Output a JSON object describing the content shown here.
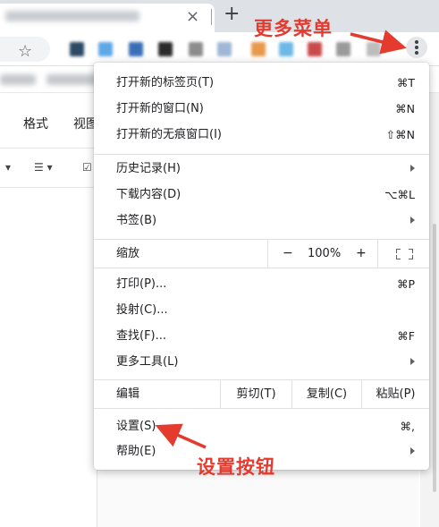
{
  "browser": {
    "tab_close": "×",
    "new_tab": "+",
    "bookmark_star": "☆"
  },
  "doc": {
    "menus": [
      "格式",
      "视图"
    ],
    "toolbar": [
      "▾",
      "☰ ▾",
      "☑"
    ]
  },
  "menu": {
    "items": [
      {
        "label": "打开新的标签页(T)",
        "shortcut": "⌘T"
      },
      {
        "label": "打开新的窗口(N)",
        "shortcut": "⌘N"
      },
      {
        "label": "打开新的无痕窗口(I)",
        "shortcut": "⇧⌘N"
      },
      {
        "label": "历史记录(H)",
        "submenu": true
      },
      {
        "label": "下载内容(D)",
        "shortcut": "⌥⌘L"
      },
      {
        "label": "书签(B)",
        "submenu": true
      },
      {
        "label": "打印(P)...",
        "shortcut": "⌘P"
      },
      {
        "label": "投射(C)..."
      },
      {
        "label": "查找(F)...",
        "shortcut": "⌘F"
      },
      {
        "label": "更多工具(L)",
        "submenu": true
      },
      {
        "label": "设置(S)",
        "shortcut": "⌘,"
      },
      {
        "label": "帮助(E)",
        "submenu": true
      }
    ],
    "zoom": {
      "label": "缩放",
      "minus": "−",
      "value": "100%",
      "plus": "+"
    },
    "edit": {
      "label": "编辑",
      "cut": "剪切(T)",
      "copy": "复制(C)",
      "paste": "粘贴(P)"
    }
  },
  "annotations": {
    "more_menu": "更多菜单",
    "settings_button": "设置按钮",
    "color": "#e53a2e"
  }
}
